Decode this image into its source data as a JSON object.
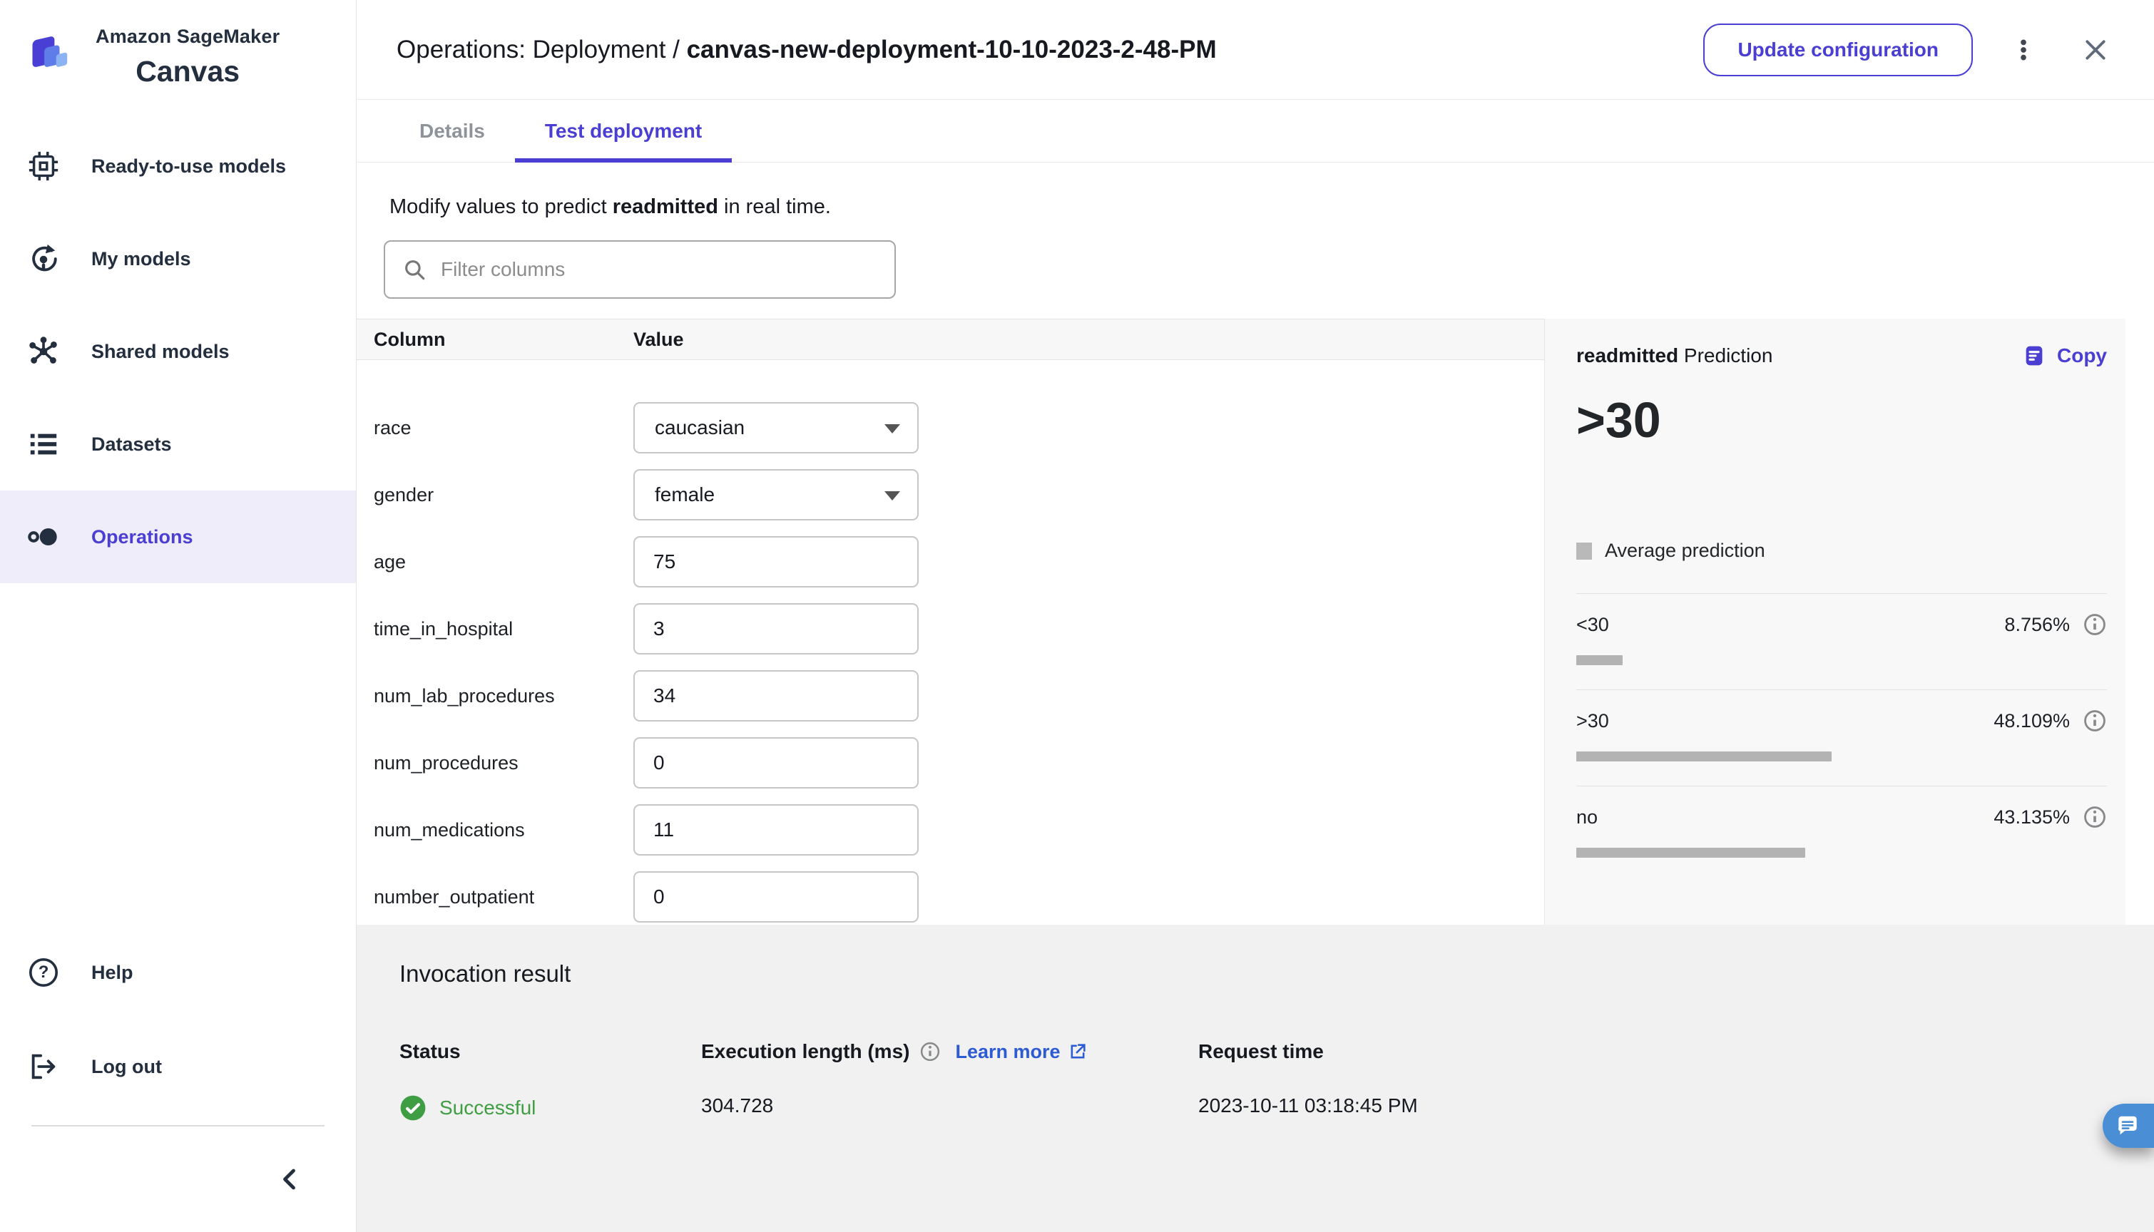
{
  "colors": {
    "accent": "#4b3fd3",
    "link_blue": "#2d5bd4",
    "success_green": "#3f9e44",
    "chat_blue": "#4a8ed6",
    "bar_gray": "#b3b3b3"
  },
  "sidebar": {
    "brand": {
      "line1": "Amazon SageMaker",
      "line2": "Canvas"
    },
    "items": [
      {
        "label": "Ready-to-use models",
        "icon": "chip-icon",
        "active": false
      },
      {
        "label": "My models",
        "icon": "model-refresh-icon",
        "active": false
      },
      {
        "label": "Shared models",
        "icon": "network-icon",
        "active": false
      },
      {
        "label": "Datasets",
        "icon": "list-icon",
        "active": false
      },
      {
        "label": "Operations",
        "icon": "operations-icon",
        "active": true
      }
    ],
    "footer_items": [
      {
        "label": "Help",
        "icon": "help-icon"
      },
      {
        "label": "Log out",
        "icon": "logout-icon"
      }
    ]
  },
  "header": {
    "title_prefix": "Operations: Deployment / ",
    "title_name": "canvas-new-deployment-10-10-2023-2-48-PM",
    "update_button_label": "Update configuration"
  },
  "tabs": [
    {
      "label": "Details",
      "active": false
    },
    {
      "label": "Test deployment",
      "active": true
    }
  ],
  "content": {
    "intro_prefix": "Modify values to predict ",
    "intro_target": "readmitted",
    "intro_suffix": " in real time.",
    "filter_placeholder": "Filter columns"
  },
  "form": {
    "headers": {
      "column": "Column",
      "value": "Value"
    },
    "rows": [
      {
        "label": "race",
        "type": "select",
        "value": "caucasian"
      },
      {
        "label": "gender",
        "type": "select",
        "value": "female"
      },
      {
        "label": "age",
        "type": "input",
        "value": "75"
      },
      {
        "label": "time_in_hospital",
        "type": "input",
        "value": "3"
      },
      {
        "label": "num_lab_procedures",
        "type": "input",
        "value": "34"
      },
      {
        "label": "num_procedures",
        "type": "input",
        "value": "0"
      },
      {
        "label": "num_medications",
        "type": "input",
        "value": "11"
      },
      {
        "label": "number_outpatient",
        "type": "input",
        "value": "0"
      }
    ]
  },
  "prediction": {
    "title_target": "readmitted",
    "title_suffix": " Prediction",
    "copy_label": "Copy",
    "predicted_value": ">30",
    "legend_label": "Average prediction",
    "rows": [
      {
        "label": "<30",
        "pct_label": "8.756%",
        "pct": 8.756
      },
      {
        "label": ">30",
        "pct_label": "48.109%",
        "pct": 48.109
      },
      {
        "label": "no",
        "pct_label": "43.135%",
        "pct": 43.135
      }
    ]
  },
  "invocation": {
    "title": "Invocation result",
    "status_header": "Status",
    "status_value": "Successful",
    "execution_header": "Execution length (ms)",
    "learn_more_label": "Learn more",
    "execution_value": "304.728",
    "request_header": "Request time",
    "request_value": "2023-10-11 03:18:45 PM"
  }
}
